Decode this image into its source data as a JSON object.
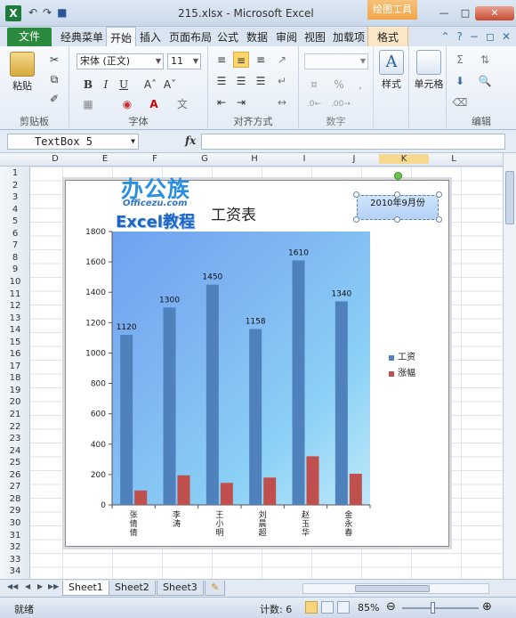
{
  "window": {
    "title": "215.xlsx - Microsoft Excel",
    "context_tab_title": "绘图工具",
    "min": "—",
    "max": "□",
    "close": "✕"
  },
  "qat": {
    "undo": "↶",
    "redo": "↷",
    "save": "■"
  },
  "tabs": {
    "file": "文件",
    "items": [
      "经典菜单",
      "开始",
      "插入",
      "页面布局",
      "公式",
      "数据",
      "审阅",
      "视图",
      "加载项"
    ],
    "active_index": 1,
    "context": "格式"
  },
  "ribbon": {
    "clipboard": {
      "label": "剪贴板",
      "paste": "粘贴"
    },
    "font": {
      "label": "字体",
      "name": "宋体 (正文)",
      "size": "11"
    },
    "alignment": {
      "label": "对齐方式"
    },
    "number": {
      "label": "数字"
    },
    "styles": {
      "label": "样式"
    },
    "cells": {
      "label": "单元格"
    },
    "editing": {
      "label": "编辑"
    }
  },
  "formula_bar": {
    "name_box": "TextBox 5",
    "fx": "fx",
    "content": ""
  },
  "columns": [
    "D",
    "E",
    "F",
    "G",
    "H",
    "I",
    "J",
    "K",
    "L"
  ],
  "rows": [
    "1",
    "2",
    "3",
    "4",
    "5",
    "6",
    "7",
    "8",
    "9",
    "10",
    "11",
    "12",
    "13",
    "14",
    "15",
    "16",
    "17",
    "18",
    "19",
    "20",
    "21",
    "22",
    "23",
    "24",
    "25",
    "26",
    "27",
    "28",
    "29",
    "30",
    "31",
    "32",
    "33",
    "34"
  ],
  "chart": {
    "logo_big": "办公族",
    "logo_small": "Officezu.com",
    "logo_excel": "Excel教程",
    "textbox": "2010年9月份"
  },
  "chart_data": {
    "type": "bar",
    "title": "工资表",
    "categories": [
      "张倩倩",
      "李涛",
      "王小明",
      "刘晨超",
      "赵玉华",
      "金永春"
    ],
    "series": [
      {
        "name": "工资",
        "values": [
          1120,
          1300,
          1450,
          1158,
          1610,
          1340
        ],
        "color": "#4f81bd",
        "labels": [
          "1120",
          "1300",
          "1450",
          "1158",
          "1610",
          "1340"
        ]
      },
      {
        "name": "涨幅",
        "values": [
          95,
          195,
          145,
          180,
          320,
          205
        ],
        "color": "#c0504d"
      }
    ],
    "ylim": [
      0,
      1800
    ],
    "yticks": [
      "0",
      "200",
      "400",
      "600",
      "800",
      "1000",
      "1200",
      "1400",
      "1600",
      "1800"
    ],
    "legend_position": "right",
    "grid": false
  },
  "sheet_tabs": [
    "Sheet1",
    "Sheet2",
    "Sheet3"
  ],
  "active_sheet": 0,
  "status": {
    "ready": "就绪",
    "count": "计数: 6",
    "zoom": "85%"
  }
}
